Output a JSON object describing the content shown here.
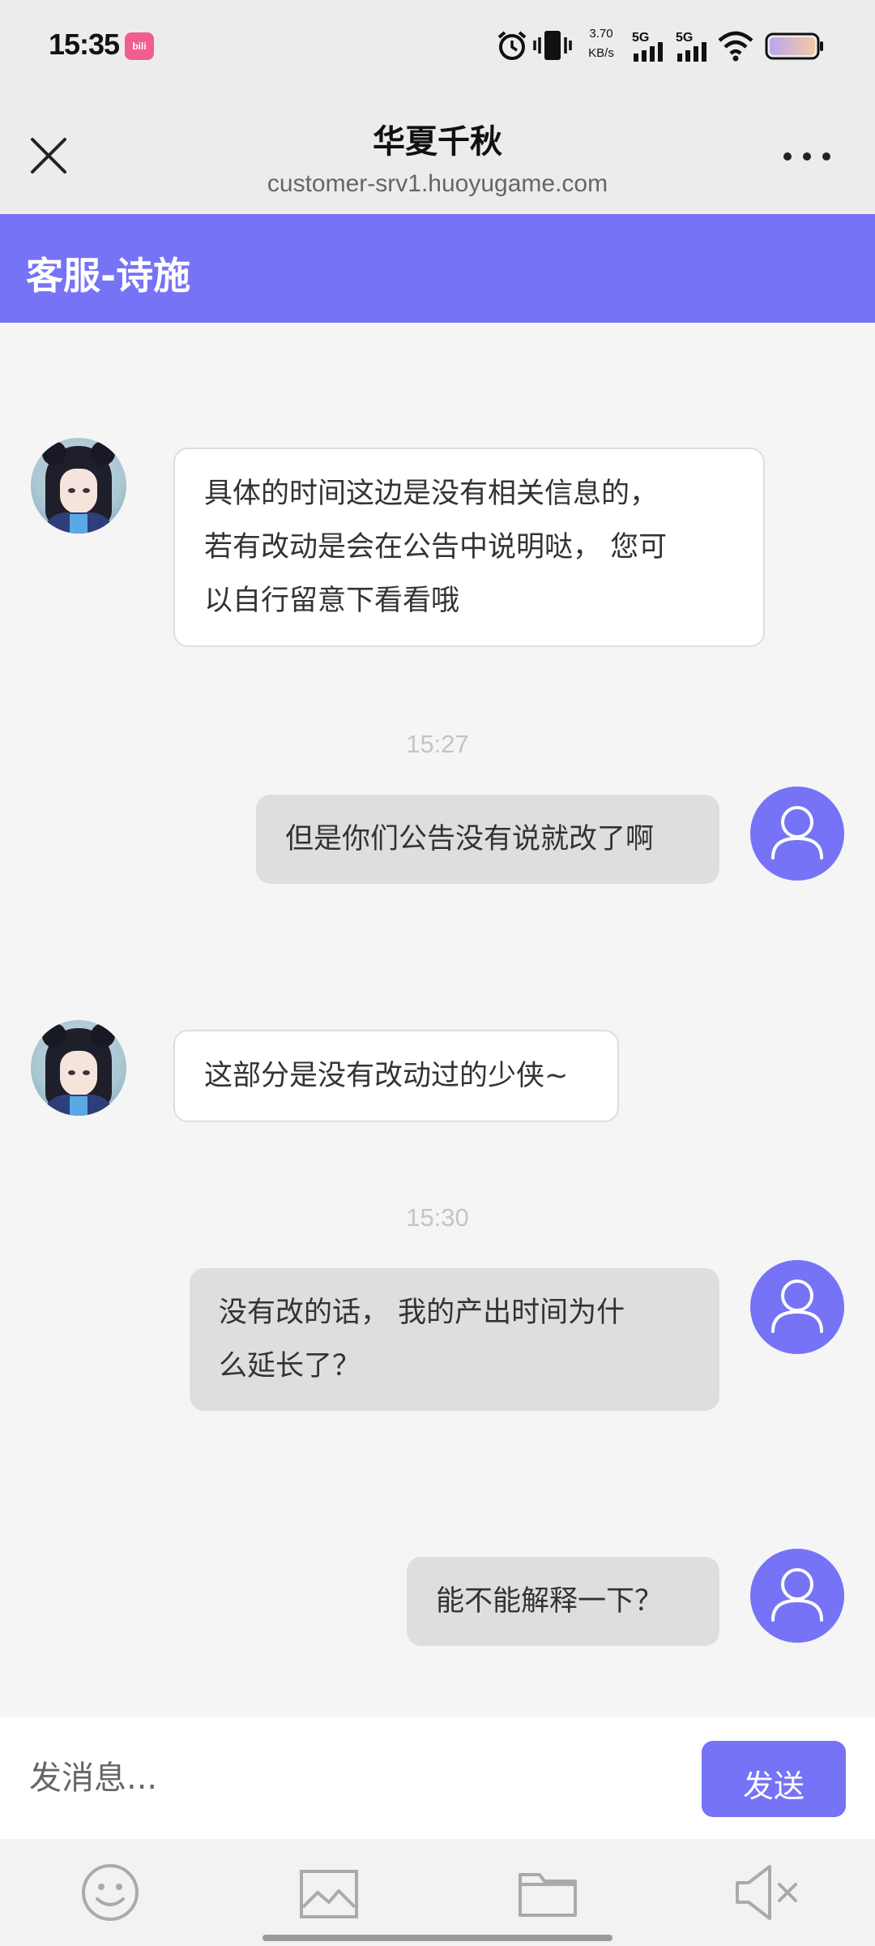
{
  "status_bar": {
    "time": "15:35",
    "app_icon_label": "bili",
    "net_speed_value": "3.70",
    "net_speed_unit": "KB/s",
    "sim1": "5G",
    "sim2": "5G",
    "icons": [
      "alarm-icon",
      "vibrate-icon",
      "signal-icon",
      "signal-icon",
      "wifi-icon",
      "battery-icon"
    ]
  },
  "header": {
    "title": "华夏千秋",
    "url": "customer-srv1.huoyugame.com"
  },
  "agent_bar": {
    "name": "客服-诗施"
  },
  "messages": [
    {
      "sender": "agent",
      "text_lines": [
        "具体的时间这边是没有相关信息的，",
        "若有改动是会在公告中说明哒， 您可",
        "以自行留意下看看哦"
      ]
    },
    {
      "timestamp": "15:27"
    },
    {
      "sender": "user",
      "text_lines": [
        "但是你们公告没有说就改了啊"
      ]
    },
    {
      "sender": "agent",
      "text_lines": [
        "这部分是没有改动过的少侠~"
      ]
    },
    {
      "timestamp": "15:30"
    },
    {
      "sender": "user",
      "text_lines": [
        "没有改的话， 我的产出时间为什",
        "么延长了？"
      ]
    },
    {
      "sender": "user",
      "text_lines": [
        "能不能解释一下？"
      ]
    }
  ],
  "input": {
    "placeholder": "发消息...",
    "send_label": "发送"
  },
  "toolbar": {
    "items": [
      "emoji-icon",
      "image-icon",
      "folder-icon",
      "mute-icon"
    ]
  },
  "colors": {
    "accent": "#7673f6",
    "user_bubble": "#dedede",
    "agent_bubble": "#ffffff",
    "background": "#f5f5f5"
  }
}
